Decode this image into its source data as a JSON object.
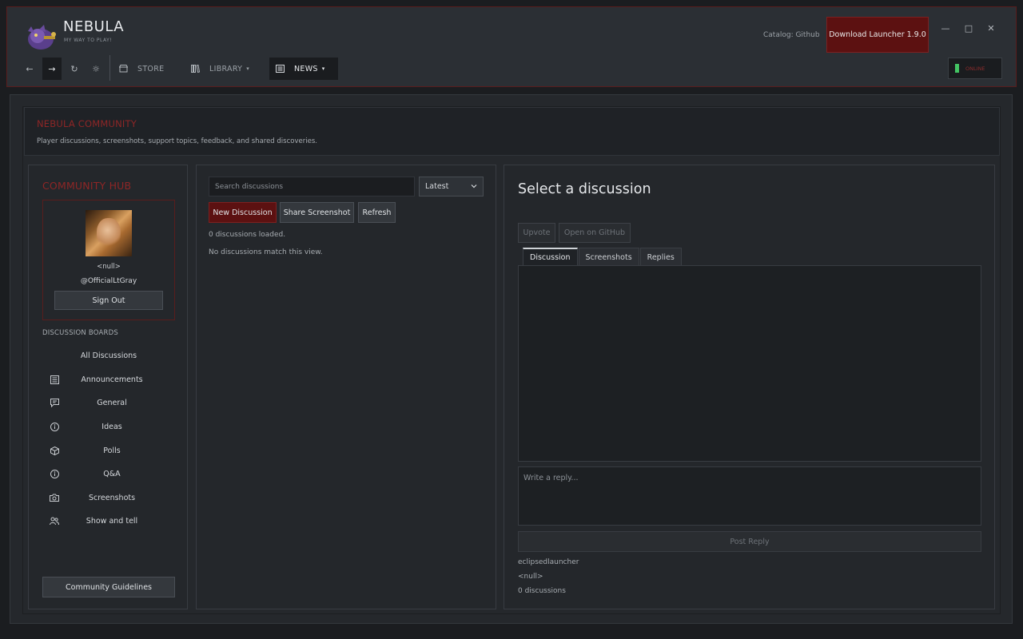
{
  "app": {
    "title": "NEBULA",
    "subtitle": "MY WAY TO PLAY!",
    "catalog": "Catalog: Github",
    "download_label": "Download Launcher 1.9.0",
    "window_controls": {
      "minimize": "—",
      "maximize": "□",
      "close": "✕"
    }
  },
  "nav": {
    "back": "←",
    "forward": "→",
    "refresh": "↻",
    "settings": "☼",
    "tabs": [
      {
        "label": "STORE",
        "icon": "store-icon"
      },
      {
        "label": "LIBRARY",
        "icon": "library-icon",
        "caret": "▾"
      },
      {
        "label": "NEWS",
        "icon": "news-icon",
        "caret": "▾"
      }
    ],
    "status": "ONLINE",
    "status_color": "#43c463"
  },
  "header": {
    "title": "NEBULA COMMUNITY",
    "subtitle": "Player discussions, screenshots, support topics, feedback, and shared discoveries."
  },
  "sidebar": {
    "title": "COMMUNITY HUB",
    "profile": {
      "name": "<null>",
      "handle": "@OfficialLtGray",
      "sign_out": "Sign Out"
    },
    "boards_label": "DISCUSSION BOARDS",
    "boards": [
      {
        "label": "All Discussions",
        "icon": ""
      },
      {
        "label": "Announcements",
        "icon": "announcements-icon"
      },
      {
        "label": "General",
        "icon": "chat-icon"
      },
      {
        "label": "Ideas",
        "icon": "info-icon"
      },
      {
        "label": "Polls",
        "icon": "cube-icon"
      },
      {
        "label": "Q&A",
        "icon": "info-icon"
      },
      {
        "label": "Screenshots",
        "icon": "camera-icon"
      },
      {
        "label": "Show and tell",
        "icon": "users-icon"
      }
    ],
    "guidelines": "Community Guidelines"
  },
  "middle": {
    "search_placeholder": "Search discussions",
    "sort_value": "Latest",
    "new_discussion": "New Discussion",
    "share_screenshot": "Share Screenshot",
    "refresh": "Refresh",
    "loaded_status": "0 discussions loaded.",
    "empty_status": "No discussions match this view."
  },
  "detail": {
    "title": "Select a discussion",
    "upvote": "Upvote",
    "open_github": "Open on GitHub",
    "tabs": [
      "Discussion",
      "Screenshots",
      "Replies"
    ],
    "reply_placeholder": "Write a reply...",
    "post_reply": "Post Reply",
    "meta_repo": "eclipsedlauncher",
    "meta_user": "<null>",
    "meta_count": "0 discussions"
  },
  "colors": {
    "accent_red": "#8e2626",
    "button_red": "#5c1111",
    "online_green": "#43c463"
  }
}
